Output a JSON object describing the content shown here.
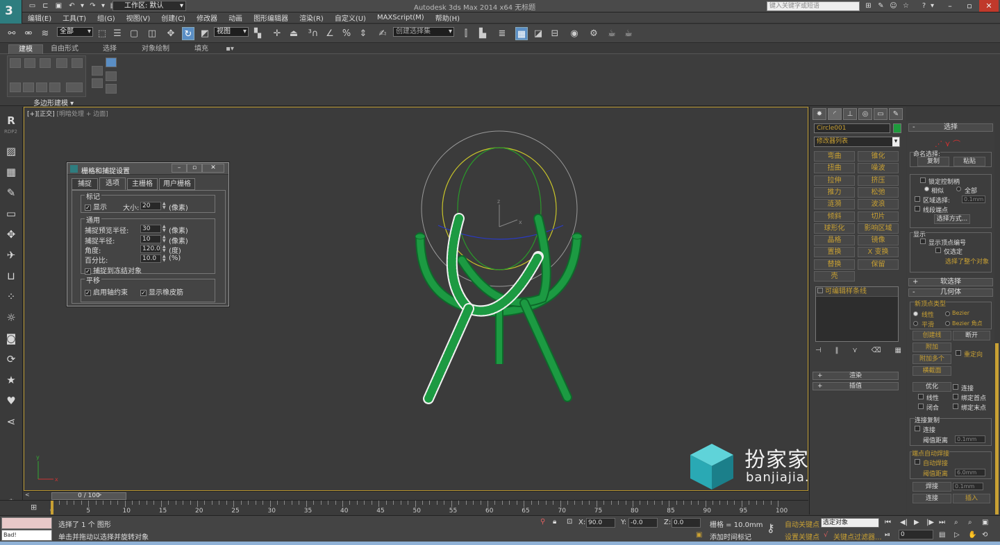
{
  "titlebar": {
    "workspace_label": "工作区: 默认",
    "app_title": "Autodesk 3ds Max  2014 x64     无标题",
    "search_placeholder": "键入关键字或短语",
    "logo_letter": "3"
  },
  "menus": [
    "编辑(E)",
    "工具(T)",
    "组(G)",
    "视图(V)",
    "创建(C)",
    "修改器",
    "动画",
    "图形编辑器",
    "渲染(R)",
    "自定义(U)",
    "MAXScript(M)",
    "帮助(H)"
  ],
  "toolbar": {
    "selection_filter": "全部",
    "ref_coord": "视图",
    "named_selection": "创建选择集"
  },
  "ribbon": {
    "tabs": [
      "建模",
      "自由形式",
      "选择",
      "对象绘制",
      "填充"
    ],
    "panel_title": "多边形建模 ▾"
  },
  "left_toolbar": {
    "r_label": "R",
    "r_sub": "RDP2"
  },
  "viewport": {
    "label_left": "[+]",
    "label_view": "[正交]",
    "label_shading": "[明暗处理 + 边面]",
    "axis_x": "x",
    "axis_y": "y",
    "axis_z": "z"
  },
  "dialog": {
    "title": "栅格和捕捉设置",
    "tabs": [
      "捕捉",
      "选项",
      "主栅格",
      "用户栅格"
    ],
    "marker_group": "标记",
    "display_label": "显示",
    "size_label": "大小:",
    "size_value": "20",
    "pixels": "(像素)",
    "general_group": "通用",
    "preview_radius_label": "捕捉预览半径:",
    "preview_radius_value": "30",
    "snap_radius_label": "捕捉半径:",
    "snap_radius_value": "10",
    "angle_label": "角度:",
    "angle_value": "120.0",
    "angle_unit": "(度)",
    "percent_label": "百分比:",
    "percent_value": "10.0",
    "percent_unit": "(%)",
    "snap_frozen_label": "捕捉到冻结对象",
    "translation_group": "平移",
    "axis_constraint_label": "启用轴约束",
    "rubber_band_label": "显示橡皮筋",
    "check_mark": "✓"
  },
  "command_panel": {
    "object_name": "Circle001",
    "object_color": "#1e9a3c",
    "modifier_list": "修改器列表",
    "modifiers": [
      "弯曲",
      "锥化",
      "扭曲",
      "噪波",
      "拉伸",
      "挤压",
      "推力",
      "松弛",
      "涟漪",
      "波浪",
      "倾斜",
      "切片",
      "球形化",
      "影响区域",
      "晶格",
      "镜像",
      "置换",
      "X 变换",
      "替换",
      "保留",
      "壳"
    ],
    "stack_item": "可编辑样条线",
    "render_rollout": "渲染",
    "interp_rollout": "插值"
  },
  "rollouts": {
    "select_title": "选择",
    "named_sel": "命名选择:",
    "copy": "复制",
    "paste": "粘贴",
    "lock_handles": "锁定控制柄",
    "similar": "相似",
    "all": "全部",
    "area_select": "区域选择:",
    "area_value": "0.1mm",
    "segment_end": "线段端点",
    "select_by": "选择方式...",
    "display": "显示",
    "show_vertex_numbers": "显示顶点编号",
    "only_selected": "仅选定",
    "selected_whole": "选择了整个对象",
    "soft_selection": "软选择",
    "geometry": "几何体",
    "new_vertex_type": "新顶点类型",
    "linear": "线性",
    "bezier": "Bezier",
    "smooth": "平滑",
    "bezier_corner": "Bezier 角点",
    "create_line": "创建线",
    "break": "断开",
    "attach": "附加",
    "attach_multiple": "附加多个",
    "reorient": "重定向",
    "cross_section": "横截面",
    "optimize": "优化",
    "connect": "连接",
    "linear2": "线性",
    "bind_first": "绑定首点",
    "closed": "闭合",
    "bind_last": "绑定末点",
    "connect_copy": "连接复制",
    "connect2": "连接",
    "threshold": "阈值距离",
    "threshold_value": "0.1mm",
    "auto_weld_group": "端点自动焊接",
    "auto_weld": "自动焊接",
    "threshold2": "阈值距离",
    "threshold2_value": "6.0mm",
    "weld": "焊接",
    "weld_value": "0.1mm",
    "connect3": "连接",
    "insert": "插入"
  },
  "timeline": {
    "frame": "0 / 100",
    "ticks": [
      "0",
      "5",
      "10",
      "15",
      "20",
      "25",
      "30",
      "35",
      "40",
      "45",
      "50",
      "55",
      "60",
      "65",
      "70",
      "75",
      "80",
      "85",
      "90",
      "95",
      "100"
    ]
  },
  "status": {
    "maxscript_value": "Bad!",
    "selected_msg": "选择了 1 个 图形",
    "prompt_msg": "单击并拖动以选择并旋转对象",
    "x_label": "X:",
    "x_value": "90.0",
    "y_label": "Y:",
    "y_value": "-0.0",
    "z_label": "Z:",
    "z_value": "0.0",
    "grid": "栅格 = 10.0mm",
    "auto_key": "自动关键点",
    "set_key": "设置关键点",
    "key_mode": "选定对象",
    "key_filters": "关键点过滤器...",
    "add_time_tag": "添加时间标记",
    "frame_value": "0"
  },
  "watermark": {
    "text": "扮家家室内设计",
    "url": "banjiajia.com"
  }
}
